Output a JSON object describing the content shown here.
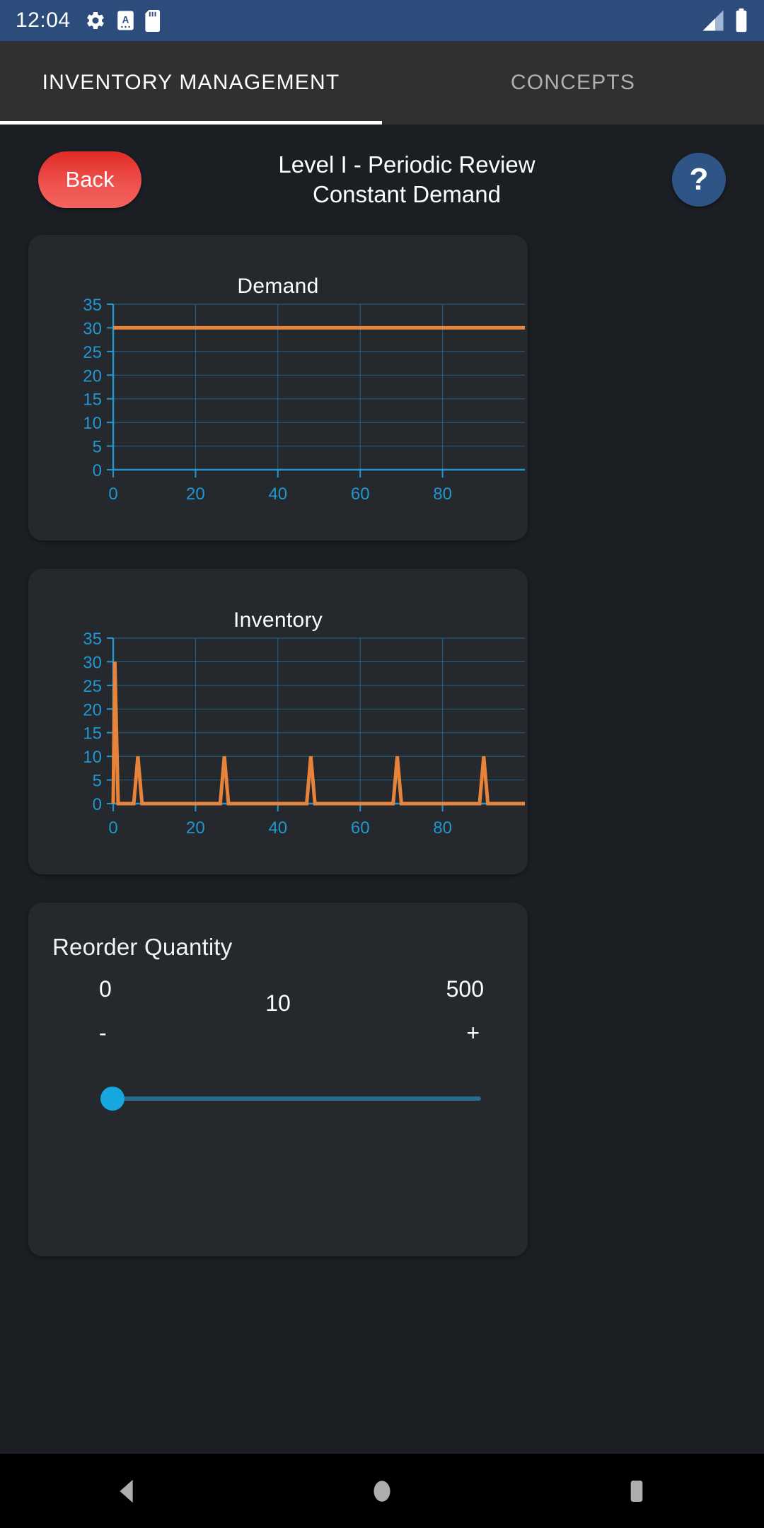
{
  "status_bar": {
    "time": "12:04",
    "icons": [
      "gear-icon",
      "letter-a-icon",
      "sd-card-icon"
    ],
    "right_icons": [
      "signal-icon",
      "battery-icon"
    ],
    "background_color": "#2c4c7c"
  },
  "tabs": [
    {
      "label": "INVENTORY MANAGEMENT",
      "active": true
    },
    {
      "label": "CONCEPTS",
      "active": false
    }
  ],
  "header": {
    "back_label": "Back",
    "title_line1": "Level I - Periodic Review",
    "title_line2": "Constant Demand",
    "help_label": "?",
    "back_color": "#ef5350",
    "help_color": "#2f5586"
  },
  "chart_data": [
    {
      "type": "line",
      "title": "Demand",
      "xlabel": "",
      "ylabel": "",
      "xlim": [
        0,
        100
      ],
      "ylim": [
        0,
        35
      ],
      "xticks": [
        0,
        20,
        40,
        60,
        80
      ],
      "yticks": [
        0,
        5,
        10,
        15,
        20,
        25,
        30,
        35
      ],
      "grid": true,
      "line_color": "#e8833a",
      "axis_color": "#2196cf",
      "series": [
        {
          "name": "Demand",
          "constant_value": 30,
          "x": [
            0,
            100
          ],
          "values": [
            30,
            30
          ]
        }
      ]
    },
    {
      "type": "line",
      "title": "Inventory",
      "xlabel": "",
      "ylabel": "",
      "xlim": [
        0,
        100
      ],
      "ylim": [
        0,
        35
      ],
      "xticks": [
        0,
        20,
        40,
        60,
        80
      ],
      "yticks": [
        0,
        5,
        10,
        15,
        20,
        25,
        30,
        35
      ],
      "grid": true,
      "line_color": "#e8833a",
      "axis_color": "#2196cf",
      "series": [
        {
          "name": "Inventory",
          "peak_value": 10,
          "initial_value": 30,
          "spike_x": [
            6,
            27,
            48,
            69,
            90
          ],
          "x": [
            0,
            0.4,
            1.2,
            5.0,
            6.0,
            7.0,
            26.0,
            27.0,
            28.0,
            47.0,
            48.0,
            49.0,
            68.0,
            69.0,
            70.0,
            89.0,
            90.0,
            91.0,
            100
          ],
          "values": [
            0,
            30,
            0,
            0,
            10,
            0,
            0,
            10,
            0,
            0,
            10,
            0,
            0,
            10,
            0,
            0,
            10,
            0,
            0
          ]
        }
      ]
    }
  ],
  "reorder": {
    "title": "Reorder Quantity",
    "min": "0",
    "value": "10",
    "max": "500",
    "minus_label": "-",
    "plus_label": "+",
    "slider_percent": 2,
    "accent_color": "#17a7e0"
  },
  "navbar": {
    "back_icon": "triangle-back-icon",
    "home_icon": "circle-home-icon",
    "recents_icon": "square-recents-icon"
  }
}
